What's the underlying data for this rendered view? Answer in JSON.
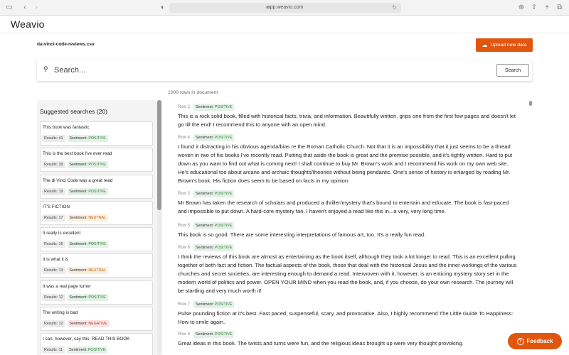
{
  "browser": {
    "url": "app.weavio.com"
  },
  "app": {
    "logo": "Weavio",
    "filename": "da-vinci-code-reviews.csv",
    "upload_label": "Upload new data"
  },
  "search": {
    "placeholder": "Search...",
    "button_label": "Search"
  },
  "rows_count": "1000 rows in document",
  "sidebar": {
    "title": "Suggested searches (20)",
    "items": [
      {
        "query": "This book was fantastic",
        "results": "Results: 41",
        "sentiment_label": "Sentiment:",
        "sentiment": "POSITIVE"
      },
      {
        "query": "This is the best book I've ever read",
        "results": "Results: 39",
        "sentiment_label": "Sentiment:",
        "sentiment": "POSITIVE"
      },
      {
        "query": "The di Vinci Code was a great read",
        "results": "Results: 19",
        "sentiment_label": "Sentiment:",
        "sentiment": "POSITIVE"
      },
      {
        "query": "IT'S FICTION",
        "results": "Results: 17",
        "sentiment_label": "Sentiment:",
        "sentiment": "NEUTRAL"
      },
      {
        "query": "It really is excellent",
        "results": "Results: 16",
        "sentiment_label": "Sentiment:",
        "sentiment": "POSITIVE"
      },
      {
        "query": "It is what it is",
        "results": "Results: 13",
        "sentiment_label": "Sentiment:",
        "sentiment": "NEUTRAL"
      },
      {
        "query": "It was a real page turner",
        "results": "Results: 12",
        "sentiment_label": "Sentiment:",
        "sentiment": "POSITIVE"
      },
      {
        "query": "The writing is bad",
        "results": "Results: 12",
        "sentiment_label": "Sentiment:",
        "sentiment": "NEGATIVE"
      },
      {
        "query": "I can, however, say this: READ THIS BOOK",
        "results": "Results: 11",
        "sentiment_label": "Sentiment:",
        "sentiment": "POSITIVE"
      }
    ]
  },
  "rows": [
    {
      "label": "Row 2",
      "sentiment_label": "Sentiment:",
      "sentiment": "POSITIVE",
      "text": "This is a rock solid book, filled with historical facts, trivia, and information. Beautifully written, grips one from the first few pages and doesn't let go till the end! I recommend this to anyone with an open mind."
    },
    {
      "label": "Row 4",
      "sentiment_label": "Sentiment:",
      "sentiment": "POSITIVE",
      "text": "I found it distracting in his obvious agenda/bias re the Roman Catholic Church. Not that it is an impossibility that it just seems to be a thread woven in two of his books I've recently read. Putting that aside the book is great and the premise possible, and it's tightly written. Hard to put down as you want to find out what is coming next! I shall continue to buy Mr. Brown's work and I recommend his work on my own web site. He's educational too about arcane and archaic thoughts/theories without being pendantic. One's sense of history is enlarged by reading Mr. Brown's book. His fiction does seem to be based on facts in my opinion."
    },
    {
      "label": "Row 3",
      "sentiment_label": "Sentiment:",
      "sentiment": "POSITIVE",
      "text": "Mr Brown has taken the research of scholars and produced a thriller/mystery that's bound to entertain and educate. The book is fast-paced and impossible to put down. A hard-core mystery fan, I haven't enjoyed a read like this in...a very, very long time."
    },
    {
      "label": "Row 5",
      "sentiment_label": "Sentiment:",
      "sentiment": "POSITIVE",
      "text": "This book is so good. There are some interesting interpretations of famous art, too. It's a really fun read."
    },
    {
      "label": "Row 6",
      "sentiment_label": "Sentiment:",
      "sentiment": "POSITIVE",
      "text": "I think the reviews of this book are almost as entertaining as the book itself, although they took a lot longer to read. This is an excellent pulling together of both fact and fiction. The factual aspects of the book, those that deal with the historical Jesus and the inner workings of the various churches and secret societies, are interesting enough to demand a read. Interwoven with it, however, is an enticing mystery story set in the modern world of politics and power. OPEN YOUR MIND when you read the book, and, if you choose, do your own research. The journey will be startling and very much worth it!"
    },
    {
      "label": "Row 7",
      "sentiment_label": "Sentiment:",
      "sentiment": "POSITIVE",
      "text": "Pulse pounding fiction at it's best. Fast paced, suspenseful, scary, and provocative. Also, I highly recommend The Little Guide To Happiness: How to smile again."
    },
    {
      "label": "Row 8",
      "sentiment_label": "Sentiment:",
      "sentiment": "POSITIVE",
      "text": "Great ideas in this book. The twists and turns were fun, and the religious ideas brought up were very thought provoking."
    }
  ],
  "feedback_label": "Feedback",
  "colors": {
    "accent": "#e1560f",
    "positive": "#2e7d3b",
    "neutral": "#c26a10",
    "negative": "#c62828"
  }
}
